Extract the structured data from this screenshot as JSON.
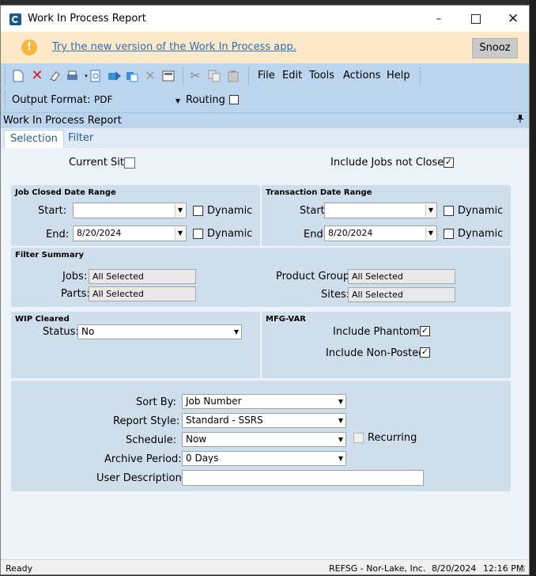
{
  "window": {
    "title": "Work In Process Report",
    "minimize": "–",
    "close": "✕"
  },
  "banner": {
    "link_text": "Try the new version of the Work In Process app.",
    "snooze_label": "Snooz",
    "warn_glyph": "!"
  },
  "toolbar": {
    "icons": [
      "new-icon",
      "delete-icon",
      "clear-icon",
      "print-icon",
      "print-preview-icon",
      "send-icon",
      "copy-icon",
      "cancel-icon",
      "save-icon",
      "cut-icon",
      "copy-clip-icon",
      "paste-icon"
    ],
    "menus": [
      "File",
      "Edit",
      "Tools",
      "Actions",
      "Help"
    ],
    "output_format_label": "Output Format:",
    "output_format_value": "PDF",
    "routing_label": "Routing"
  },
  "panel": {
    "title": "Work In Process Report",
    "pin_glyph": "ᵖ"
  },
  "tabs": [
    "Selection",
    "Filter"
  ],
  "selection": {
    "current_site_label": "Current Site:",
    "include_jobs_label": "Include Jobs not Closed:",
    "include_jobs_checked": true,
    "job_closed": {
      "title": "Job Closed Date Range",
      "start_label": "Start:",
      "start_value": "",
      "end_label": "End:",
      "end_value": "8/20/2024",
      "dynamic_label": "Dynamic"
    },
    "transaction": {
      "title": "Transaction Date Range",
      "start_label": "Start:",
      "start_value": "",
      "end_label": "End:",
      "end_value": "8/20/2024",
      "dynamic_label": "Dynamic"
    },
    "filter_summary": {
      "title": "Filter Summary",
      "jobs_label": "Jobs:",
      "jobs_value": "All Selected",
      "parts_label": "Parts:",
      "parts_value": "All Selected",
      "product_groups_label": "Product Groups:",
      "product_groups_value": "All Selected",
      "sites_label": "Sites:",
      "sites_value": "All Selected"
    },
    "wip_cleared": {
      "title": "WIP Cleared",
      "status_label": "Status:",
      "status_value": "No"
    },
    "mfg_var": {
      "title": "MFG-VAR",
      "phantoms_label": "Include Phantoms:",
      "phantoms_checked": true,
      "nonposted_label": "Include Non-Posted:",
      "nonposted_checked": true
    },
    "report": {
      "sort_by_label": "Sort By:",
      "sort_by_value": "Job Number",
      "report_style_label": "Report Style:",
      "report_style_value": "Standard - SSRS",
      "schedule_label": "Schedule:",
      "schedule_value": "Now",
      "recurring_label": "Recurring",
      "archive_label": "Archive Period:",
      "archive_value": "0 Days",
      "user_desc_label": "User Description:",
      "user_desc_value": ""
    }
  },
  "status": {
    "ready": "Ready",
    "site": "REFSG - Nor-Lake, Inc.",
    "date": "8/20/2024",
    "time": "12:16 PM"
  },
  "glyphs": {
    "check": "✓",
    "dropdown": "▼"
  }
}
